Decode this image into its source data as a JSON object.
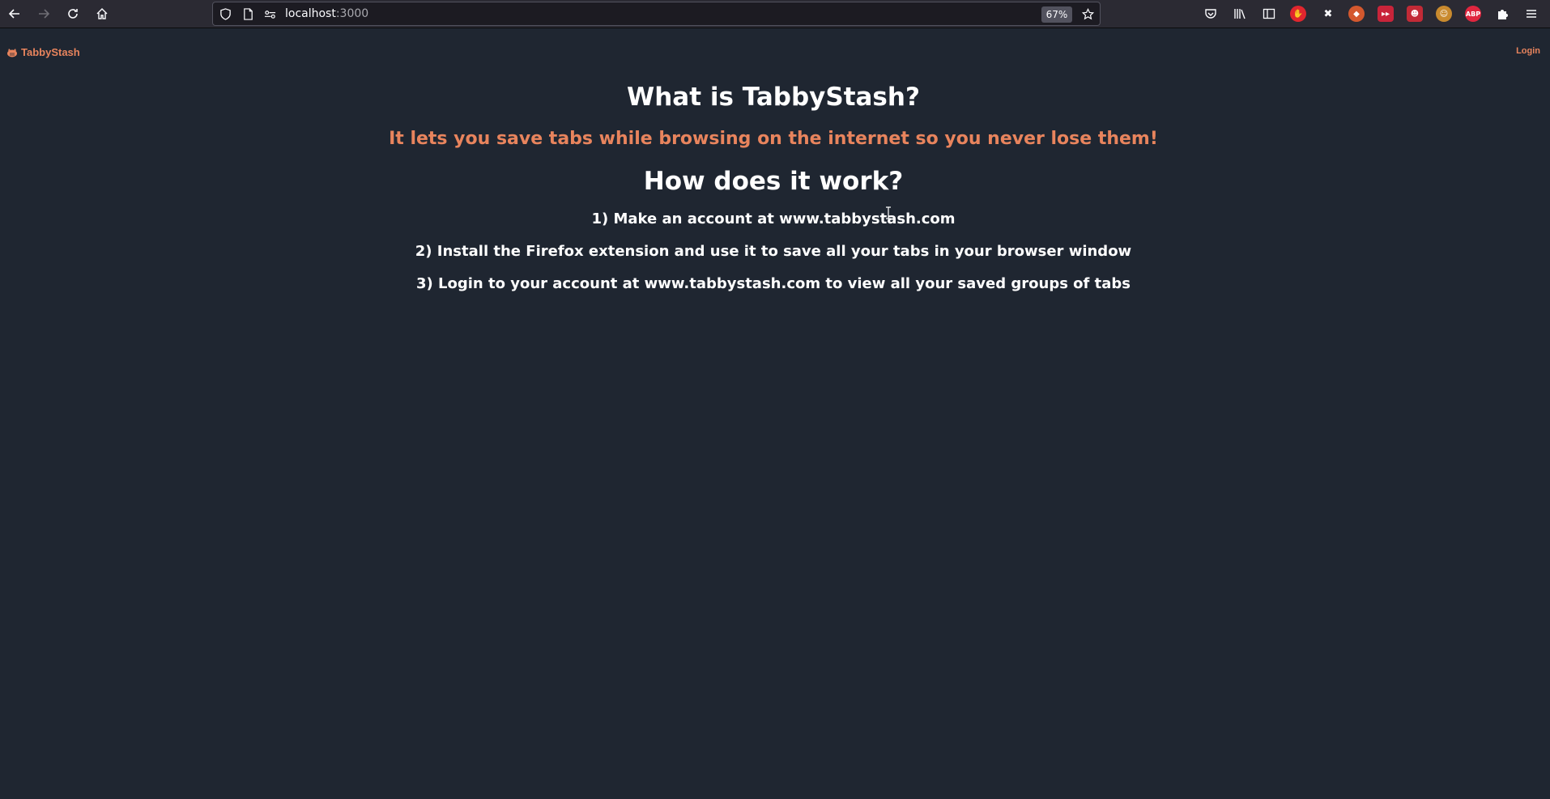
{
  "browser": {
    "url_host": "localhost",
    "url_port": ":3000",
    "zoom": "67%"
  },
  "nav": {
    "brand": "TabbyStash",
    "login": "Login"
  },
  "main": {
    "heading": "What is TabbyStash?",
    "tagline": "It lets you save tabs while browsing on the internet so you never lose them!",
    "how_heading": "How does it work?",
    "steps": [
      "1) Make an account at www.tabbystash.com",
      "2) Install the Firefox extension and use it to save all your tabs in your browser window",
      "3) Login to your account at www.tabbystash.com to view all your saved groups of tabs"
    ]
  },
  "colors": {
    "background": "#1f2631",
    "accent": "#e8845d",
    "text": "#ffffff"
  }
}
